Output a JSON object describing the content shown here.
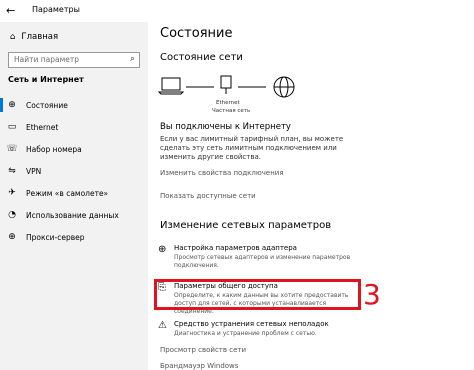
{
  "window": {
    "title": "Параметры"
  },
  "sidebar": {
    "home_label": "Главная",
    "search_placeholder": "Найти параметр",
    "section": "Сеть и Интернет",
    "items": [
      {
        "label": "Состояние",
        "icon": "globe-icon"
      },
      {
        "label": "Ethernet",
        "icon": "ethernet-icon"
      },
      {
        "label": "Набор номера",
        "icon": "dialup-icon"
      },
      {
        "label": "VPN",
        "icon": "vpn-icon"
      },
      {
        "label": "Режим «в самолете»",
        "icon": "airplane-icon"
      },
      {
        "label": "Использование данных",
        "icon": "data-usage-icon"
      },
      {
        "label": "Прокси-сервер",
        "icon": "globe-icon"
      }
    ]
  },
  "main": {
    "title": "Состояние",
    "network_status_heading": "Состояние сети",
    "diagram": {
      "device_label": "Ethernet",
      "network_label": "Частная сеть"
    },
    "connected_heading": "Вы подключены к Интернету",
    "connected_desc": "Если у вас лимитный тарифный план, вы можете сделать эту сеть лимитным подключением или изменить другие свойства.",
    "link_change_props": "Изменить свойства подключения",
    "link_show_networks": "Показать доступные сети",
    "change_heading": "Изменение сетевых параметров",
    "options": [
      {
        "title": "Настройка параметров адаптера",
        "desc": "Просмотр сетевых адаптеров и изменение параметров подключения.",
        "icon": "adapter-icon"
      },
      {
        "title": "Параметры общего доступа",
        "desc": "Определите, к каким данным вы хотите предоставить доступ для сетей, с которыми устанавливается соединение.",
        "icon": "sharing-icon"
      },
      {
        "title": "Средство устранения сетевых неполадок",
        "desc": "Диагностика и устранение проблем с сетью.",
        "icon": "warning-icon"
      }
    ],
    "link_view_props": "Просмотр свойств сети",
    "link_firewall": "Брандмауэр Windows"
  },
  "annotation": {
    "step": "3",
    "color": "#e0141e"
  },
  "accent": "#0078d7"
}
